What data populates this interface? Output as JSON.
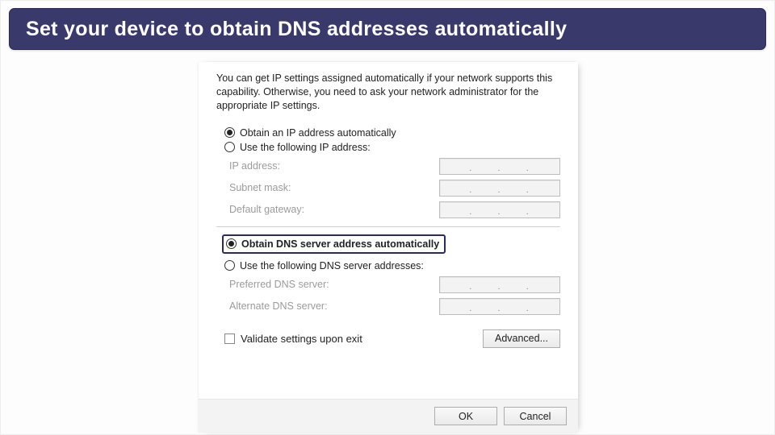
{
  "banner": {
    "text": "Set your device to obtain DNS addresses automatically"
  },
  "help": "You can get IP settings assigned automatically if your network supports this capability. Otherwise, you need to ask your network administrator for the appropriate IP settings.",
  "ip_group": {
    "auto_label": "Obtain an IP address automatically",
    "manual_label": "Use the following IP address:",
    "fields": {
      "ip_label": "IP address:",
      "subnet_label": "Subnet mask:",
      "gateway_label": "Default gateway:"
    }
  },
  "dns_group": {
    "auto_label": "Obtain DNS server address automatically",
    "manual_label": "Use the following DNS server addresses:",
    "fields": {
      "preferred_label": "Preferred DNS server:",
      "alternate_label": "Alternate DNS server:"
    }
  },
  "validate_label": "Validate settings upon exit",
  "advanced_label": "Advanced...",
  "ok_label": "OK",
  "cancel_label": "Cancel"
}
